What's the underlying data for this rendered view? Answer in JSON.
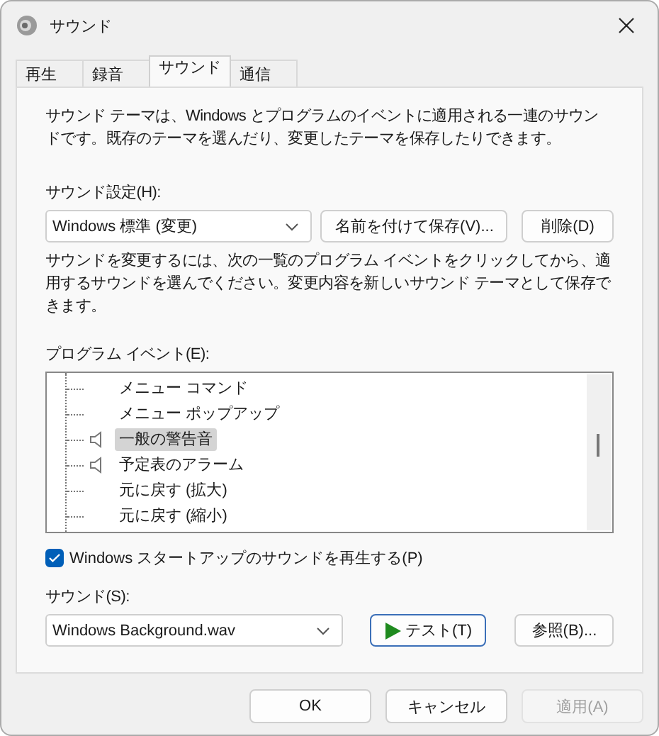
{
  "window": {
    "title": "サウンド"
  },
  "tabs": [
    {
      "label": "再生",
      "selected": false
    },
    {
      "label": "録音",
      "selected": false
    },
    {
      "label": "サウンド",
      "selected": true
    },
    {
      "label": "通信",
      "selected": false
    }
  ],
  "intro": "サウンド テーマは、Windows とプログラムのイベントに適用される一連のサウンドです。既存のテーマを選んだり、変更したテーマを保存したりできます。",
  "scheme": {
    "label": "サウンド設定(H):",
    "value": "Windows 標準 (変更)",
    "save_button": "名前を付けて保存(V)...",
    "delete_button": "削除(D)"
  },
  "instructions": "サウンドを変更するには、次の一覧のプログラム イベントをクリックしてから、適用するサウンドを選んでください。変更内容を新しいサウンド テーマとして保存できます。",
  "events": {
    "label": "プログラム イベント(E):",
    "items": [
      {
        "label": "メニュー コマンド",
        "has_sound": false,
        "selected": false
      },
      {
        "label": "メニュー ポップアップ",
        "has_sound": false,
        "selected": false
      },
      {
        "label": "一般の警告音",
        "has_sound": true,
        "selected": true
      },
      {
        "label": "予定表のアラーム",
        "has_sound": true,
        "selected": false
      },
      {
        "label": "元に戻す (拡大)",
        "has_sound": false,
        "selected": false
      },
      {
        "label": "元に戻す (縮小)",
        "has_sound": false,
        "selected": false
      }
    ]
  },
  "startup": {
    "label": "Windows スタートアップのサウンドを再生する(P)",
    "checked": true
  },
  "sound": {
    "label": "サウンド(S):",
    "value": "Windows Background.wav",
    "test_button": "テスト(T)",
    "browse_button": "参照(B)..."
  },
  "buttons": [
    {
      "label": "OK",
      "disabled": false
    },
    {
      "label": "キャンセル",
      "disabled": false
    },
    {
      "label": "適用(A)",
      "disabled": true
    }
  ]
}
